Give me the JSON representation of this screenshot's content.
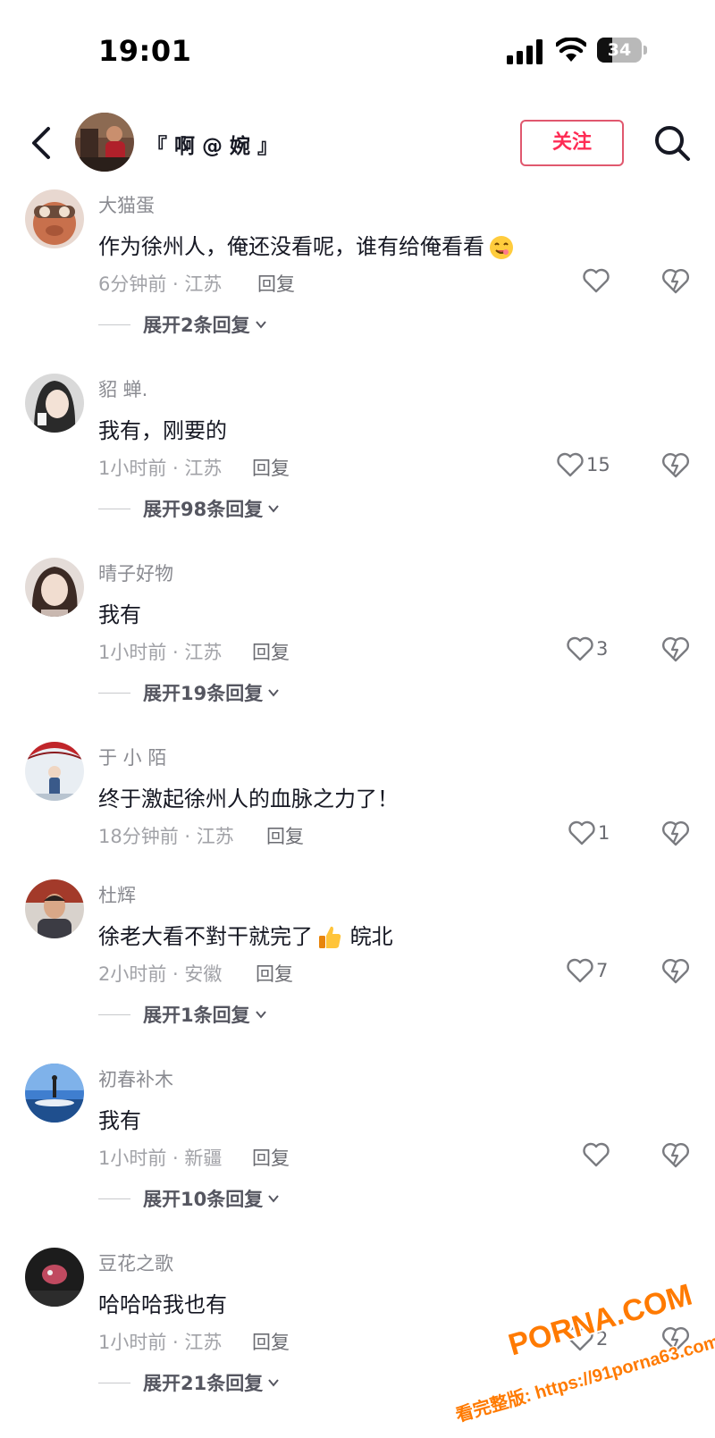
{
  "status_bar": {
    "time": "19:01",
    "battery_level": 34,
    "battery_text": "34"
  },
  "header": {
    "back_icon": "chevron-left-icon",
    "channel_name": "『 啊 @ 婉 』",
    "follow_label": "关注",
    "search_icon": "search-icon"
  },
  "colors": {
    "accent": "#fe2c55",
    "text_primary": "#161823",
    "text_secondary": "#8a8b91",
    "watermark": "#ff7a00"
  },
  "comments": [
    {
      "username": "大猫蛋",
      "text": "作为徐州人，俺还没看呢，谁有给俺看看",
      "emoji": "yummy-face-icon",
      "meta": "6分钟前 · 江苏",
      "reply_label": "回复",
      "likes": "",
      "expand": "展开2条回复"
    },
    {
      "username": "貂 蝉.",
      "text": "我有，刚要的",
      "meta": "1小时前 · 江苏",
      "reply_label": "回复",
      "likes": "15",
      "expand": "展开98条回复"
    },
    {
      "username": "晴子好物",
      "text": "我有",
      "meta": "1小时前 · 江苏",
      "reply_label": "回复",
      "likes": "3",
      "expand": "展开19条回复"
    },
    {
      "username": "于 小 陌",
      "text": "终于激起徐州人的血脉之力了！",
      "meta": "18分钟前 · 江苏",
      "reply_label": "回复",
      "likes": "1",
      "expand": ""
    },
    {
      "username": "杜辉",
      "text": "徐老大看不對干就完了",
      "text_after": "皖北",
      "emoji": "thumbs-up-icon",
      "meta": "2小时前 · 安徽",
      "reply_label": "回复",
      "likes": "7",
      "expand": "展开1条回复"
    },
    {
      "username": "初春补木",
      "text": "我有",
      "meta": "1小时前 · 新疆",
      "reply_label": "回复",
      "likes": "",
      "expand": "展开10条回复"
    },
    {
      "username": "豆花之歌",
      "text": "哈哈哈我也有",
      "meta": "1小时前 · 江苏",
      "reply_label": "回复",
      "likes": "2",
      "expand": "展开21条回复"
    }
  ],
  "watermark": {
    "logo": "PORNA.COM",
    "url": "看完整版: https://91porna63.com"
  }
}
